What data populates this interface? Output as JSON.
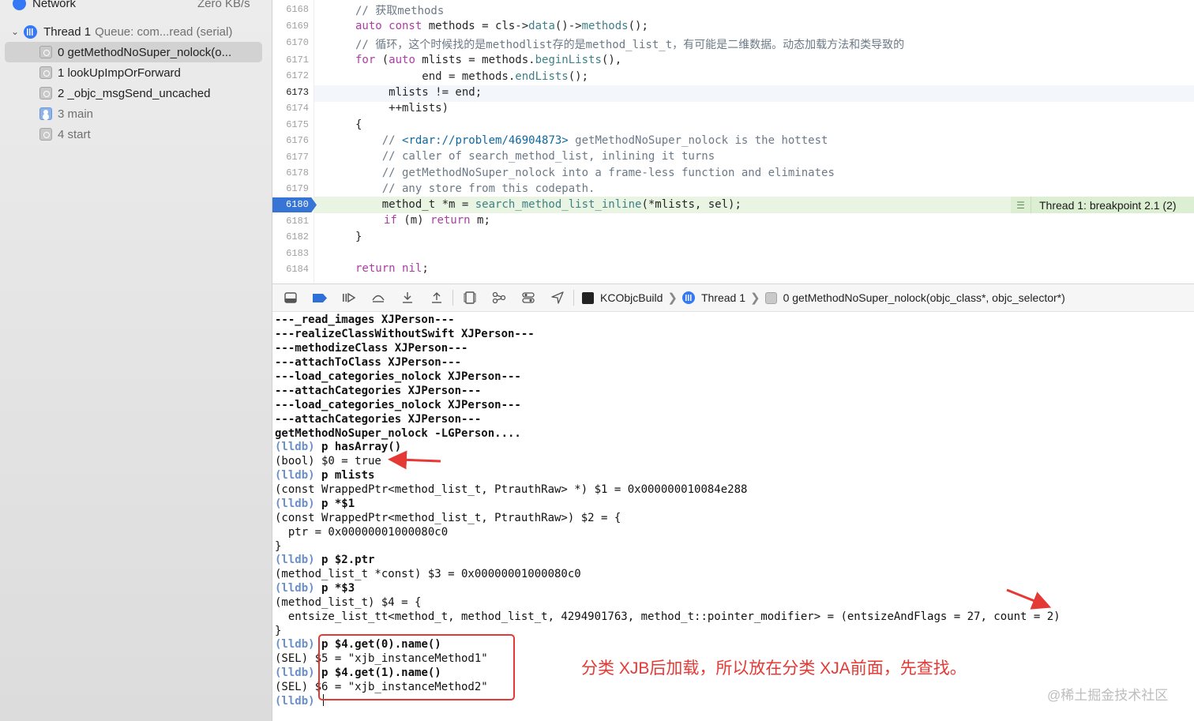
{
  "sidebar": {
    "network": {
      "label": "Network",
      "speed": "Zero KB/s"
    },
    "thread": {
      "name": "Thread 1",
      "queue": "Queue: com...read (serial)"
    },
    "frames": [
      {
        "label": "0 getMethodNoSuper_nolock(o...",
        "icon": "frame"
      },
      {
        "label": "1 lookUpImpOrForward",
        "icon": "frame"
      },
      {
        "label": "2 _objc_msgSend_uncached",
        "icon": "frame"
      },
      {
        "label": "3 main",
        "icon": "user"
      },
      {
        "label": "4 start",
        "icon": "frame"
      }
    ]
  },
  "editor": {
    "line_numbers": [
      "6168",
      "6169",
      "6170",
      "6171",
      "6172",
      "6173",
      "6174",
      "6175",
      "6176",
      "6177",
      "6178",
      "6179",
      "6180",
      "6181",
      "6182",
      "6183",
      "6184"
    ],
    "current_line": "6173",
    "breakpoint_line": "6180",
    "breakpoint_label": "Thread 1: breakpoint 2.1 (2)",
    "code": {
      "l6168": "// 获取methods",
      "l6169_kw": "auto const",
      "l6169_a": " methods = cls->",
      "l6169_fn1": "data",
      "l6169_b": "()->",
      "l6169_fn2": "methods",
      "l6169_c": "();",
      "l6170": "// 循环，这个时候找的是methodlist存的是method_list_t，有可能是二维数据。动态加载方法和类导致的",
      "l6171_kw1": "for",
      "l6171_a": " (",
      "l6171_kw2": "auto",
      "l6171_b": " mlists = methods.",
      "l6171_fn": "beginLists",
      "l6171_c": "(),",
      "l6172_a": "          end = methods.",
      "l6172_fn": "endLists",
      "l6172_c": "();",
      "l6173": "     mlists != end;",
      "l6174": "     ++mlists)",
      "l6175": "{",
      "l6176_a": "    // ",
      "l6176_link": "<rdar://problem/46904873>",
      "l6176_b": " getMethodNoSuper_nolock is the hottest",
      "l6177": "    // caller of search_method_list, inlining it turns",
      "l6178": "    // getMethodNoSuper_nolock into a frame-less function and eliminates",
      "l6179": "    // any store from this codepath.",
      "l6180_a": "    method_t *m = ",
      "l6180_fn": "search_method_list_inline",
      "l6180_b": "(*mlists, sel);",
      "l6181_kw1": "if",
      "l6181_a": " (m) ",
      "l6181_kw2": "return",
      "l6181_b": " m;",
      "l6182": "}",
      "l6184_kw": "return",
      "l6184_a": " ",
      "l6184_kw2": "nil",
      "l6184_b": ";"
    }
  },
  "debugbar": {
    "crumbs": {
      "target": "KCObjcBuild",
      "thread": "Thread 1",
      "frame": "0 getMethodNoSuper_nolock(objc_class*, objc_selector*)"
    }
  },
  "console": {
    "prompt": "(lldb)",
    "lines": {
      "o1": "---_read_images XJPerson---",
      "o2": "---realizeClassWithoutSwift XJPerson---",
      "o3": "---methodizeClass XJPerson---",
      "o4": "---attachToClass XJPerson---",
      "o5": "---load_categories_nolock XJPerson---",
      "o6": "---attachCategories XJPerson---",
      "o7": "---load_categories_nolock XJPerson---",
      "o8": "---attachCategories XJPerson---",
      "o9": "getMethodNoSuper_nolock -LGPerson....",
      "c1": " p hasArray()",
      "r1": "(bool) $0 = true",
      "c2": " p mlists",
      "r2": "(const WrappedPtr<method_list_t, PtrauthRaw> *) $1 = 0x000000010084e288",
      "c3": " p *$1",
      "r3a": "(const WrappedPtr<method_list_t, PtrauthRaw>) $2 = {",
      "r3b": "  ptr = 0x00000001000080c0",
      "r3c": "}",
      "c4": " p $2.ptr",
      "r4": "(method_list_t *const) $3 = 0x00000001000080c0",
      "c5": " p *$3",
      "r5a": "(method_list_t) $4 = {",
      "r5b": "  entsize_list_tt<method_t, method_list_t, 4294901763, method_t::pointer_modifier> = (entsizeAndFlags = 27, count = 2)",
      "r5c": "}",
      "c6": " p $4.get(0).name()",
      "r6": "(SEL) $5 = \"xjb_instanceMethod1\"",
      "c7": " p $4.get(1).name()",
      "r7": "(SEL) $6 = \"xjb_instanceMethod2\""
    }
  },
  "annotation": {
    "text": "分类 XJB后加载，所以放在分类 XJA前面，先查找。",
    "color": "#e53935"
  },
  "watermark": "@稀土掘金技术社区"
}
